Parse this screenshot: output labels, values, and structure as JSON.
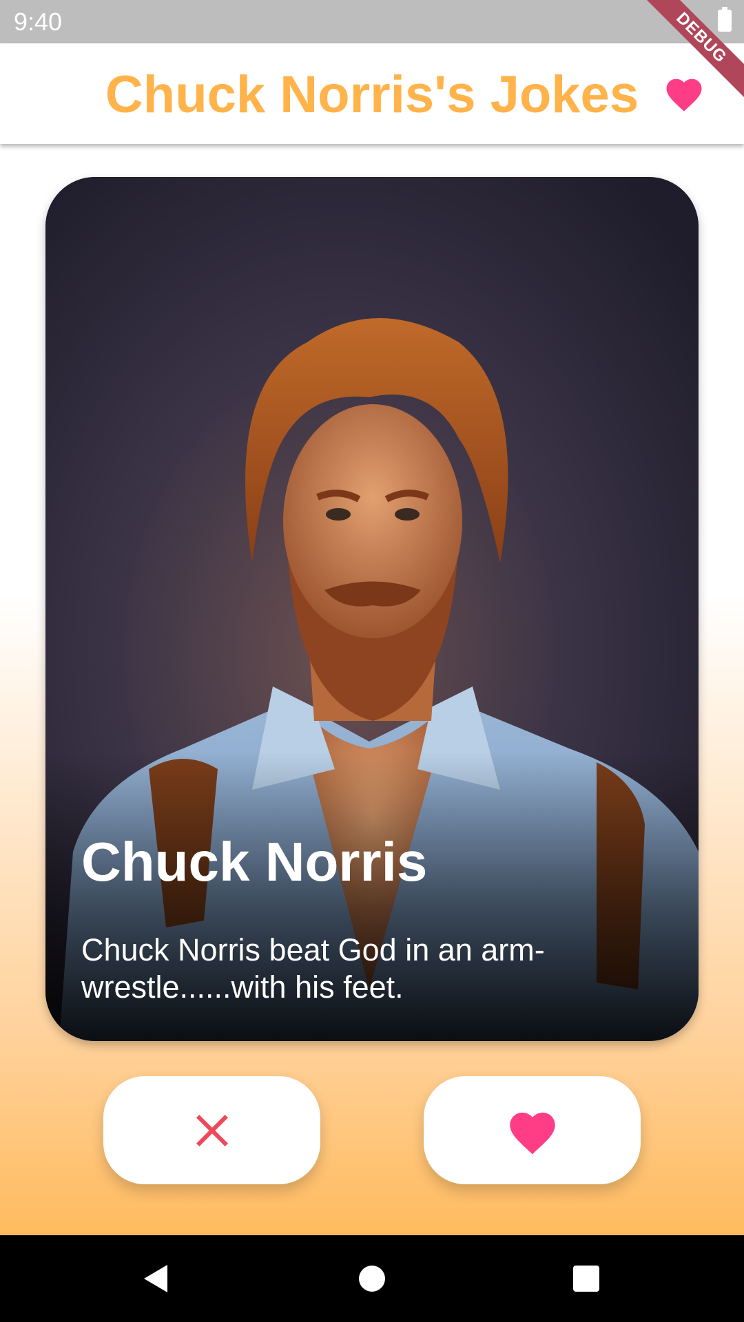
{
  "status_bar": {
    "time": "9:40"
  },
  "debug_banner": {
    "label": "DEBUG",
    "color": "#b04659"
  },
  "app_bar": {
    "title": "Chuck Norris's Jokes",
    "title_color": "#ffb34a",
    "favorites_icon": "heart-icon"
  },
  "card": {
    "name": "Chuck Norris",
    "joke": "Chuck Norris beat God in an arm-wrestle......with his feet.",
    "image": "chuck-norris-photo"
  },
  "actions": {
    "dislike_icon": "close-icon",
    "dislike_color": "#f0485a",
    "like_icon": "heart-icon",
    "like_color": "#ff3d86"
  },
  "nav_bar": {
    "back_icon": "back-triangle-icon",
    "home_icon": "home-circle-icon",
    "recents_icon": "recents-square-icon"
  },
  "colors": {
    "accent": "#ffb34a",
    "heart": "#ff3d86",
    "gradient_bottom": "#ffb24d"
  }
}
